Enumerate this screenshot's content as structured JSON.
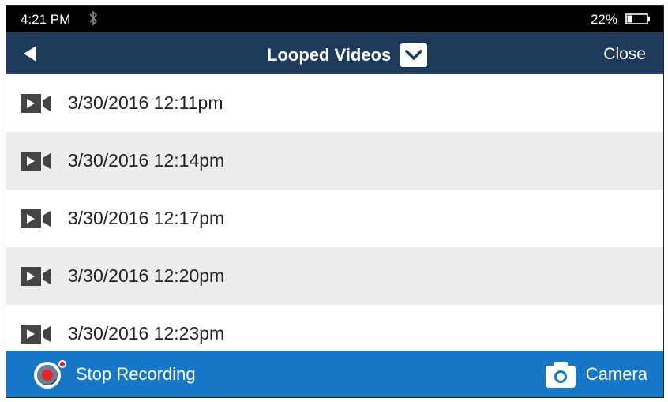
{
  "status_bar": {
    "time": "4:21 PM",
    "battery_percent": "22%",
    "battery_level": 0.22
  },
  "header": {
    "title": "Looped Videos",
    "close_label": "Close"
  },
  "videos": [
    {
      "label": "3/30/2016 12:11pm"
    },
    {
      "label": "3/30/2016 12:14pm"
    },
    {
      "label": "3/30/2016 12:17pm"
    },
    {
      "label": "3/30/2016 12:20pm"
    },
    {
      "label": "3/30/2016 12:23pm"
    }
  ],
  "footer": {
    "stop_label": "Stop Recording",
    "camera_label": "Camera"
  },
  "colors": {
    "status_bg": "#000000",
    "header_bg": "#1f3b5c",
    "footer_bg": "#1677c9",
    "alt_row": "#ededed",
    "record_red": "#e3262b"
  }
}
